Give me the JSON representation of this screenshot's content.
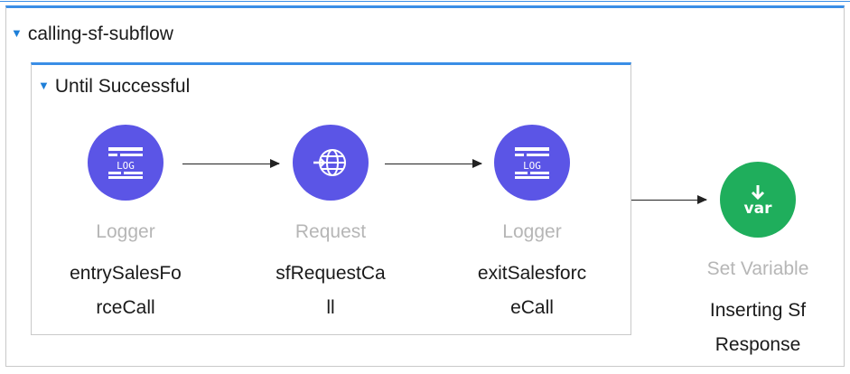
{
  "flow": {
    "title": "calling-sf-subflow",
    "scope": {
      "title": "Until Successful",
      "nodes": [
        {
          "type": "Logger",
          "name": "entrySalesFo\nrceCall",
          "icon": "log-icon"
        },
        {
          "type": "Request",
          "name": "sfRequestCa\nll",
          "icon": "globe-request-icon"
        },
        {
          "type": "Logger",
          "name": "exitSalesforc\neCall",
          "icon": "log-icon"
        }
      ]
    },
    "after": {
      "type": "Set Variable",
      "name": "Inserting Sf\nResponse",
      "icon_text": "var",
      "icon": "set-variable-icon"
    }
  },
  "colors": {
    "accent": "#3a8ee6",
    "processor": "#5b55e6",
    "variable": "#1fae5c"
  }
}
